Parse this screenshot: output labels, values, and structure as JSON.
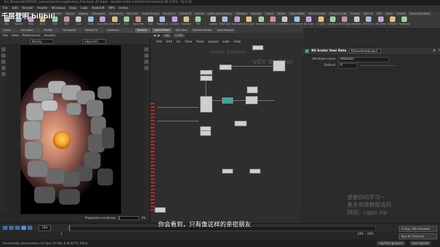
{
  "window": {
    "title": "D:/_Personal/2403/01_Lesson/record_log/lecture_1/lecture_21.hiplc - Houdini Indie Limited-Commercial 20.0.653 - Py3.10"
  },
  "menubar": [
    "File",
    "Edit",
    "Render",
    "Assets",
    "Windows",
    "Help",
    "Labs",
    "Redshift",
    "MPs",
    "Arden"
  ],
  "shelf": {
    "left_tabs": [
      "Create",
      "Modify",
      "Model",
      "Polygon",
      "Deform",
      "Texture",
      "Rigging",
      "Characters",
      "Constraints",
      "Hair Utils",
      "Guide Process",
      "Terrain FX",
      "Simple FX",
      "Volume"
    ],
    "right_tabs": [
      "Lights and Cameras",
      "Collisions",
      "Particles",
      "Grains",
      "Vellum",
      "Rigid Bodies",
      "Particle Fluids",
      "Viscous Fluids",
      "Oceans",
      "Pyro FX",
      "FEM",
      "Wires",
      "Crowds",
      "Drive Simulation"
    ],
    "left_tools": [
      "Box",
      "Sphere",
      "Tube",
      "Torus",
      "Grid",
      "Null",
      "Line",
      "Circle",
      "Curve Bezier",
      "Draw Curve",
      "Path",
      "Spray Paint",
      "Font",
      "Platonic Solids",
      "L-System",
      "Metaball",
      "File"
    ],
    "right_tools": [
      "Camera",
      "Point Light",
      "Spot Light",
      "Area Light",
      "Geometry Light",
      "Volume Light",
      "Distant Light",
      "Environment Light",
      "Sky Light",
      "GI Light",
      "Caustic Light",
      "Portal Light",
      "Ambient Light",
      "Stereo Camera",
      "VR Camera",
      "Switcher",
      "Gamepad Camera"
    ]
  },
  "left_pane": {
    "tabs": [
      "Scene View",
      "Animation Editor",
      "Render View",
      "Composite View",
      "Motion FX View",
      "Geometry Spreadsheet",
      "Redshift RV"
    ],
    "active_tab": "Redshift RV",
    "menu": [
      "File",
      "View",
      "Preferences",
      "Houdini"
    ],
    "toolbar_left": "Beauty",
    "toolbar_right": "/obj/cam1",
    "progress_label": "Progressive rendering",
    "progress_value": "3%",
    "progress_fraction": 0.03
  },
  "network": {
    "tabs": [
      "/obj/COPNet1",
      "Tree View",
      "Material Palette",
      "Asset Browser"
    ],
    "active_tab": "/obj/COPNet1",
    "path": [
      "obj",
      "COPs"
    ],
    "menu": [
      "Add",
      "Edit",
      "Go",
      "View",
      "Tools",
      "Layout",
      "Labs",
      "Help"
    ],
    "watermark_1": "Indie Edition",
    "watermark_2": "VEX Builder"
  },
  "params": {
    "op_type": "RS Scalar User Data",
    "op_name": "RSUserDataScalar1",
    "attribute_label": "Attribute name",
    "attribute_value": "emission",
    "default_label": "Default",
    "default_value": "0"
  },
  "timeline": {
    "frame": "184",
    "start": "1",
    "end_a": "240",
    "end_b": "240",
    "keys_button": "0 keys, 0/0 channels",
    "key_all_button": "Key All Channels",
    "auto_update": "Auto Update",
    "hud_label": "/obj/lithing/object"
  },
  "status": "Successfully saved lecture_21.hiplc (Fri Nov 8 00:42:51 2024)",
  "overlay": {
    "logo": "千层登明 bilibili",
    "subtitle": "你会看到，只有像这样的亲密朋友",
    "promo_line1": "感谢你的学习~",
    "promo_line2": "更多资源教程访问",
    "promo_line3": "网站：cgpp.vip"
  },
  "colors": {
    "accent_teal": "#3aa8a0",
    "playbar_blue": "#3a6ea8",
    "progress_green": "#6b8f3a"
  }
}
